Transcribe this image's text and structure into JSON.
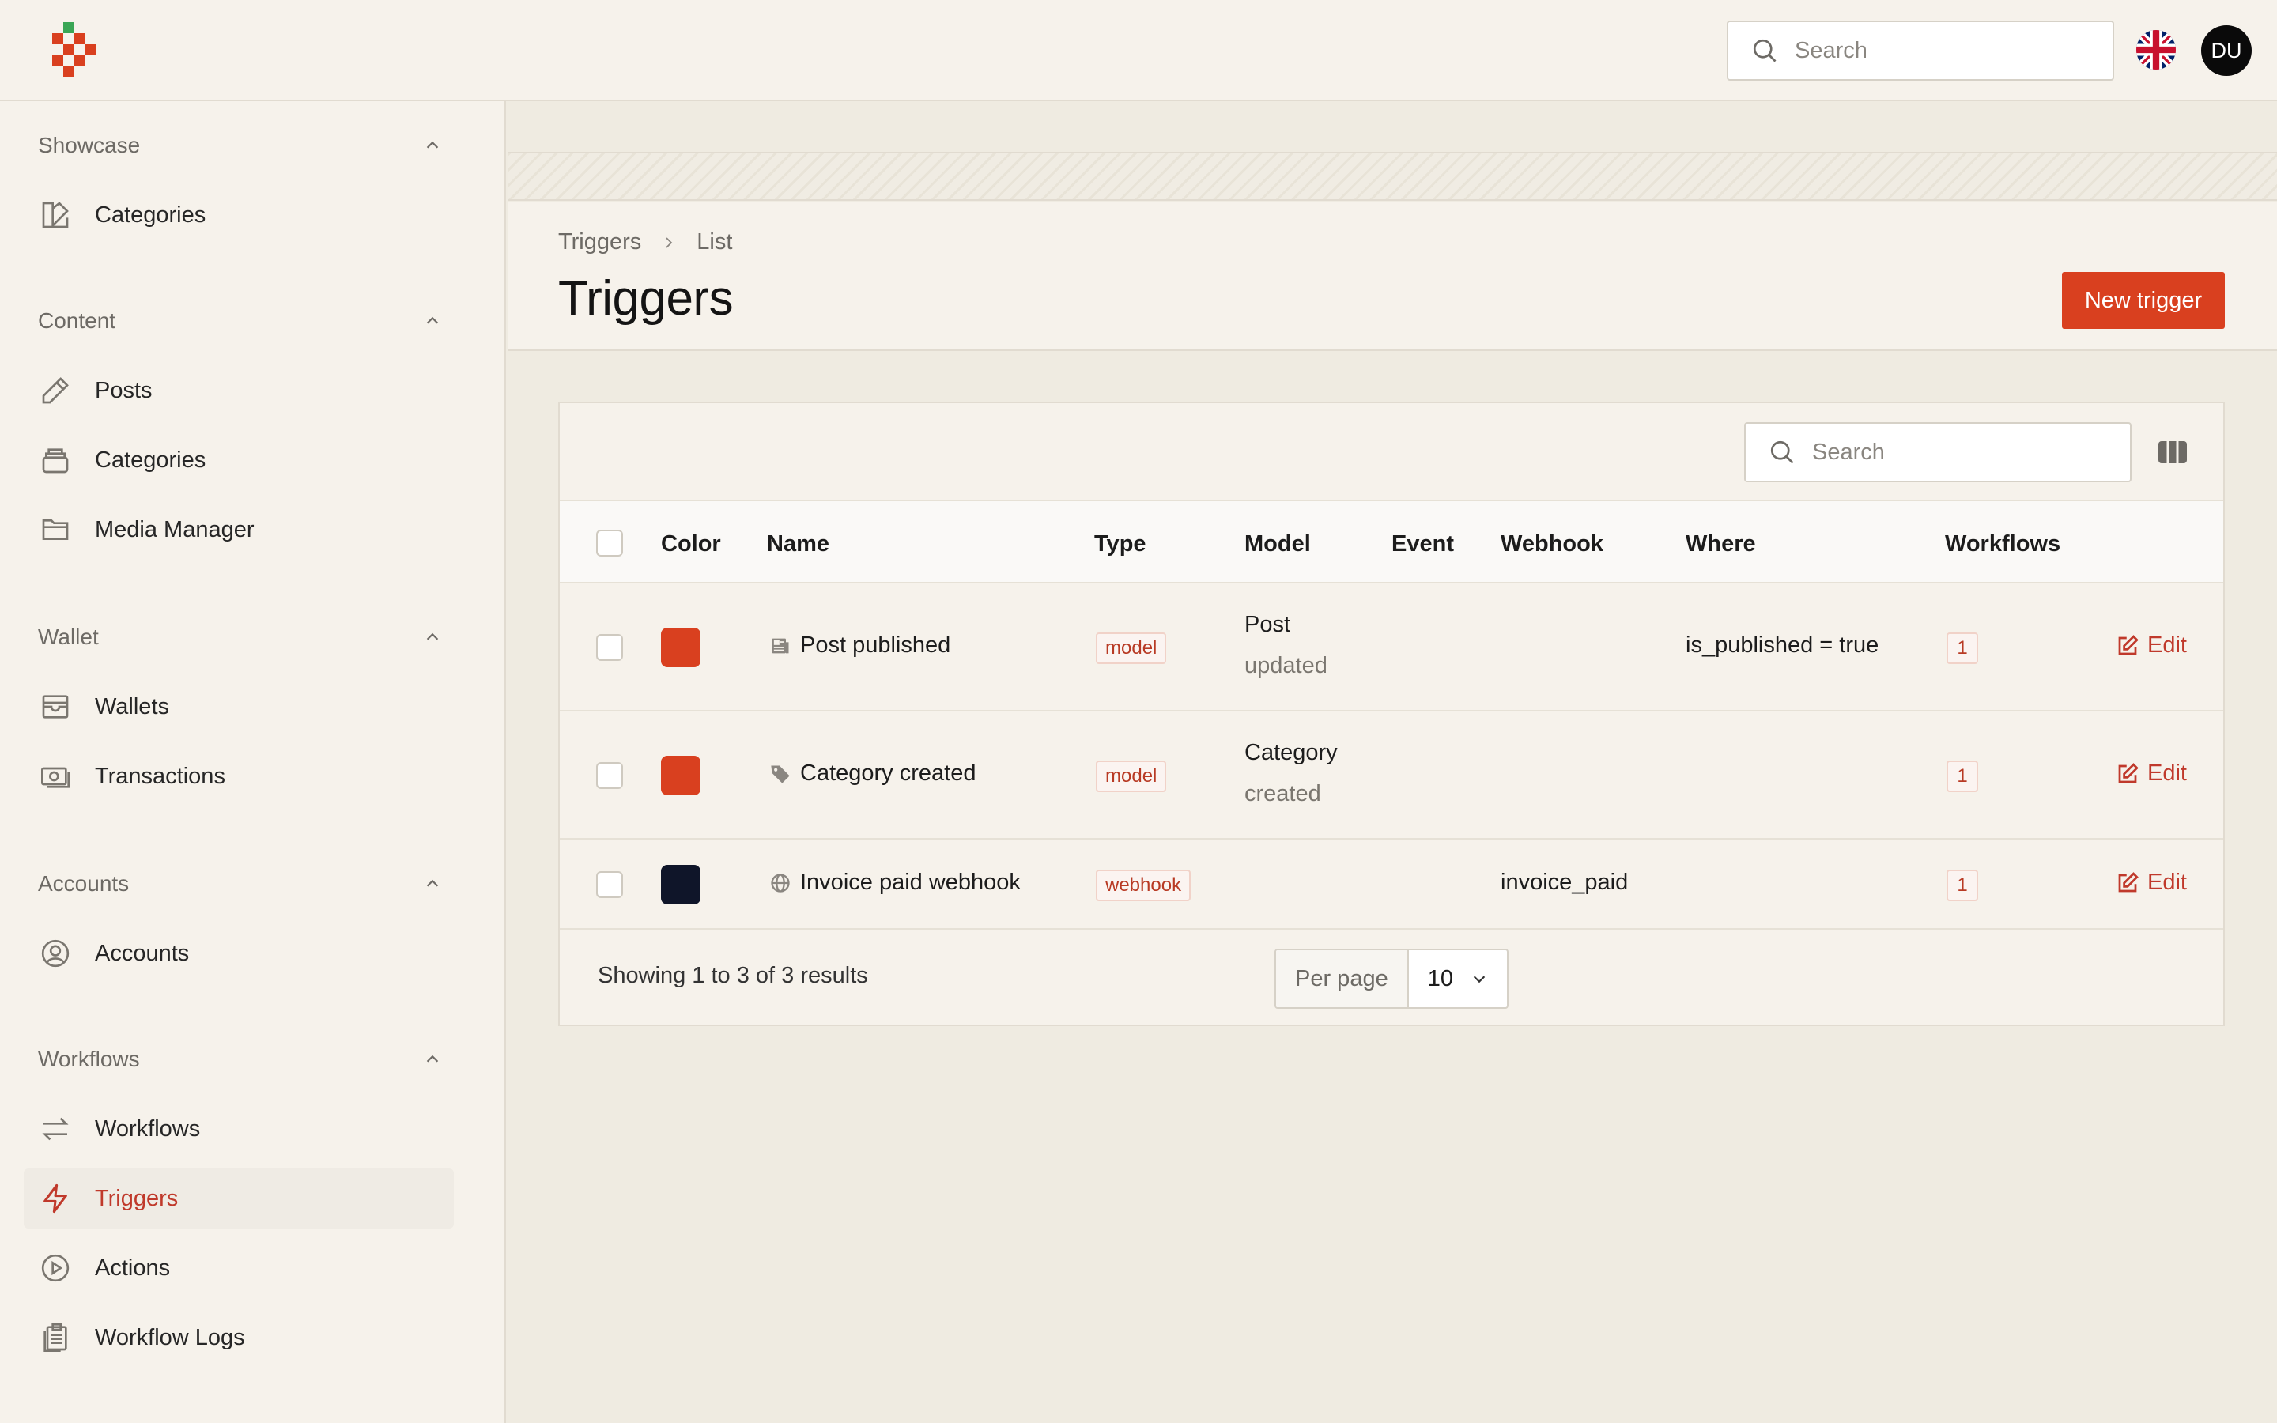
{
  "topbar": {
    "search_placeholder": "Search",
    "avatar_initials": "DU",
    "language": "en-GB"
  },
  "sidebar": {
    "groups": [
      {
        "label": "Showcase",
        "items": [
          {
            "label": "Categories",
            "icon": "categories-shapes-icon"
          }
        ]
      },
      {
        "label": "Content",
        "items": [
          {
            "label": "Posts",
            "icon": "pencil-icon"
          },
          {
            "label": "Categories",
            "icon": "stack-icon"
          },
          {
            "label": "Media Manager",
            "icon": "folder-icon"
          }
        ]
      },
      {
        "label": "Wallet",
        "items": [
          {
            "label": "Wallets",
            "icon": "wallet-icon"
          },
          {
            "label": "Transactions",
            "icon": "banknote-icon"
          }
        ]
      },
      {
        "label": "Accounts",
        "items": [
          {
            "label": "Accounts",
            "icon": "user-circle-icon"
          }
        ]
      },
      {
        "label": "Workflows",
        "items": [
          {
            "label": "Workflows",
            "icon": "arrows-swap-icon"
          },
          {
            "label": "Triggers",
            "icon": "bolt-icon",
            "active": true
          },
          {
            "label": "Actions",
            "icon": "play-circle-icon"
          },
          {
            "label": "Workflow Logs",
            "icon": "clipboard-icon"
          }
        ]
      }
    ]
  },
  "breadcrumb": {
    "parent": "Triggers",
    "current": "List"
  },
  "page": {
    "title": "Triggers",
    "new_button": "New trigger"
  },
  "table": {
    "search_placeholder": "Search",
    "columns": [
      "Color",
      "Name",
      "Type",
      "Model",
      "Event",
      "Webhook",
      "Where",
      "Workflows"
    ],
    "rows": [
      {
        "color": "#d9401f",
        "name": "Post published",
        "name_icon": "newspaper-icon",
        "type": "model",
        "model": "Post",
        "model_event": "updated",
        "event": "",
        "webhook": "",
        "where": "is_published = true",
        "workflows": "1",
        "edit": "Edit"
      },
      {
        "color": "#d9401f",
        "name": "Category created",
        "name_icon": "tag-icon",
        "type": "model",
        "model": "Category",
        "model_event": "created",
        "event": "",
        "webhook": "",
        "where": "",
        "workflows": "1",
        "edit": "Edit"
      },
      {
        "color": "#0f1529",
        "name": "Invoice paid webhook",
        "name_icon": "globe-icon",
        "type": "webhook",
        "model": "",
        "model_event": "",
        "event": "",
        "webhook": "invoice_paid",
        "where": "",
        "workflows": "1",
        "edit": "Edit"
      }
    ],
    "footer": {
      "summary": "Showing 1 to 3 of 3 results",
      "per_page_label": "Per page",
      "per_page_value": "10"
    }
  },
  "colors": {
    "accent": "#d9401f",
    "link": "#c0392b",
    "background": "#efebe1",
    "panel": "#f6f2eb"
  }
}
